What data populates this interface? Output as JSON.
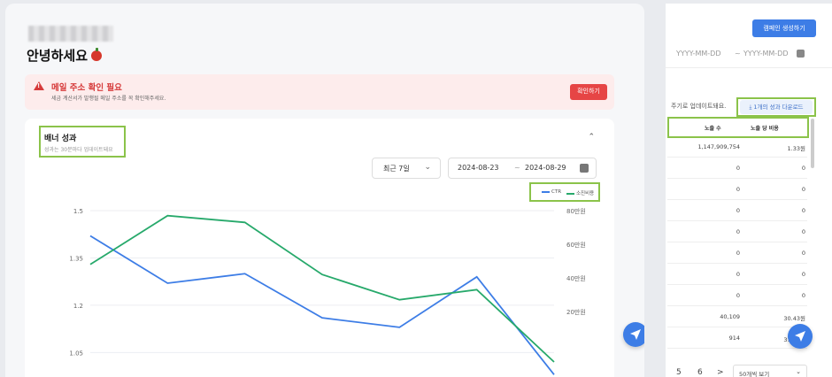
{
  "greeting": "안녕하세요",
  "alert": {
    "title": "메일 주소 확인 필요",
    "desc": "세금 계산서가 발행될 메일 주소를 꼭 확인해주세요.",
    "button": "확인하기"
  },
  "card": {
    "title": "배너 성과",
    "subtitle": "성과는 30분마다 업데이트돼요",
    "period": "최근 7일",
    "date_start": "2024-08-23",
    "date_sep": "~",
    "date_end": "2024-08-29"
  },
  "right": {
    "create_button": "캠페인 생성하기",
    "date_placeholder_start": "YYYY-MM-DD",
    "date_sep": "~",
    "date_placeholder_end": "YYYY-MM-DD",
    "update_note": "주기로 업데이트돼요.",
    "download_button": "1개의 성과 다운로드",
    "col1": "노출 수",
    "col2": "노출 당 비용",
    "rows": [
      [
        "1,147,909,754",
        "1.33원"
      ],
      [
        "0",
        "0"
      ],
      [
        "0",
        "0"
      ],
      [
        "0",
        "0"
      ],
      [
        "0",
        "0"
      ],
      [
        "0",
        "0"
      ],
      [
        "0",
        "0"
      ],
      [
        "0",
        "0"
      ],
      [
        "40,109",
        "30.43원"
      ],
      [
        "914",
        "31.51원"
      ]
    ],
    "pager": {
      "p5": "5",
      "p6": "6",
      "next": ">",
      "per_page": "50개씩 보기"
    }
  },
  "colors": {
    "accent": "#3d7de6",
    "ctr": "#3d7de6",
    "cost": "#27a96b",
    "highlight": "#8bc34a",
    "alert": "#e64545"
  },
  "chart_data": {
    "type": "line",
    "series": [
      {
        "name": "CTR",
        "axis": "left",
        "values": [
          1.42,
          1.27,
          1.3,
          1.16,
          1.13,
          1.29,
          0.98
        ]
      },
      {
        "name": "소진비용",
        "axis": "right",
        "values": [
          48,
          77,
          73,
          42,
          27,
          33,
          -10
        ]
      }
    ],
    "y_left_ticks": [
      "1.5",
      "1.35",
      "1.2",
      "1.05"
    ],
    "y_left_range": [
      0.95,
      1.5
    ],
    "y_right_ticks": [
      "80만원",
      "60만원",
      "40만원",
      "20만원"
    ],
    "y_right_range": [
      0,
      80
    ],
    "grid": true,
    "legend": "top-right"
  }
}
